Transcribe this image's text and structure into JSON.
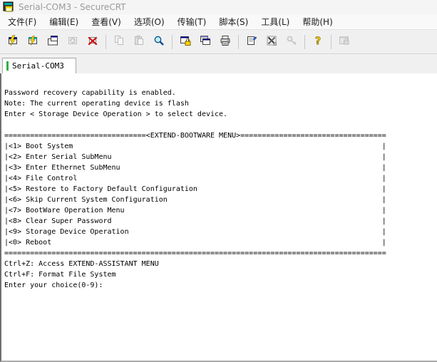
{
  "window": {
    "title": "Serial-COM3 - SecureCRT",
    "app_icon": "securecrt-session-icon"
  },
  "menu_bar": {
    "items": [
      "文件(F)",
      "编辑(E)",
      "查看(V)",
      "选项(O)",
      "传输(T)",
      "脚本(S)",
      "工具(L)",
      "帮助(H)"
    ]
  },
  "toolbar": {
    "buttons": [
      {
        "icon": "quick-connect-icon",
        "enabled": true
      },
      {
        "icon": "connect-icon",
        "enabled": true
      },
      {
        "icon": "connect-in-tab-icon",
        "enabled": true
      },
      {
        "icon": "reconnect-icon",
        "enabled": false
      },
      {
        "icon": "disconnect-icon",
        "enabled": true
      },
      {
        "sep": true
      },
      {
        "icon": "copy-icon",
        "enabled": false
      },
      {
        "icon": "paste-icon",
        "enabled": false
      },
      {
        "icon": "find-icon",
        "enabled": true
      },
      {
        "sep": true
      },
      {
        "icon": "session-lock-icon",
        "enabled": true
      },
      {
        "icon": "clone-session-icon",
        "enabled": true
      },
      {
        "icon": "print-icon",
        "enabled": true
      },
      {
        "sep": true
      },
      {
        "icon": "session-options-icon",
        "enabled": true
      },
      {
        "icon": "global-options-icon",
        "enabled": true
      },
      {
        "icon": "key-agent-icon",
        "enabled": false
      },
      {
        "sep": true
      },
      {
        "icon": "help-icon",
        "enabled": true
      },
      {
        "sep": true
      },
      {
        "icon": "lock-session-icon",
        "enabled": false
      }
    ]
  },
  "tab_bar": {
    "tabs": [
      {
        "label": "Serial-COM3",
        "active": true,
        "status_color": "#2eb141"
      }
    ]
  },
  "terminal": {
    "intro_lines": [
      "Password recovery capability is enabled.",
      "Note: The current operating device is flash",
      "Enter < Storage Device Operation > to select device."
    ],
    "menu": {
      "title": "<EXTEND-BOOTWARE MENU>",
      "width": 89,
      "fill_char": "=",
      "items": [
        "<1> Boot System",
        "<2> Enter Serial SubMenu",
        "<3> Enter Ethernet SubMenu",
        "<4> File Control",
        "<5> Restore to Factory Default Configuration",
        "<6> Skip Current System Configuration",
        "<7> BootWare Operation Menu",
        "<8> Clear Super Password",
        "<9> Storage Device Operation",
        "<0> Reboot"
      ]
    },
    "footer_lines": [
      "Ctrl+Z: Access EXTEND-ASSISTANT MENU",
      "Ctrl+F: Format File System",
      "Enter your choice(0-9):"
    ]
  },
  "colors": {
    "terminal_bg": "#ffffff",
    "terminal_fg": "#000000",
    "tab_status_green": "#2eb141",
    "title_fg": "#9b9b9b"
  }
}
